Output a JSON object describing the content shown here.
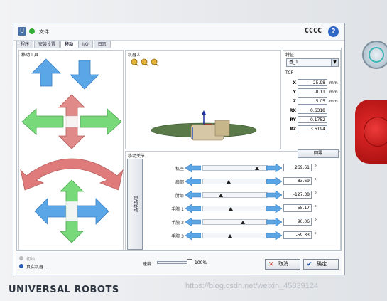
{
  "window": {
    "file_label": "文件",
    "title": "CCCC",
    "help": "?"
  },
  "tabs": [
    {
      "label": "程序"
    },
    {
      "label": "安装设置"
    },
    {
      "label": "移动"
    },
    {
      "label": "I/O"
    },
    {
      "label": "日志"
    }
  ],
  "move_tool": {
    "title": "移动工具"
  },
  "robot": {
    "title": "机器人"
  },
  "feature": {
    "title": "特征",
    "selected": "基_1",
    "tcp_title": "TCP",
    "tcp": [
      {
        "axis": "X",
        "value": "-25.98",
        "unit": "mm"
      },
      {
        "axis": "Y",
        "value": "-0.11",
        "unit": "mm"
      },
      {
        "axis": "Z",
        "value": "5.05",
        "unit": "mm"
      },
      {
        "axis": "RX",
        "value": "0.6318",
        "unit": ""
      },
      {
        "axis": "RY",
        "value": "-0.1752",
        "unit": ""
      },
      {
        "axis": "RZ",
        "value": "3.6194",
        "unit": ""
      }
    ],
    "zero_button": "回零"
  },
  "joints": {
    "title": "移动关节",
    "auto_button": "自动移动",
    "rows": [
      {
        "label": "机座",
        "value": "269.61",
        "unit": "°",
        "level": 0.85
      },
      {
        "label": "肩部",
        "value": "-83.69",
        "unit": "°",
        "level": 0.38
      },
      {
        "label": "肘部",
        "value": "-127.38",
        "unit": "°",
        "level": 0.25
      },
      {
        "label": "手腕 1",
        "value": "-55.17",
        "unit": "°",
        "level": 0.42
      },
      {
        "label": "手腕 2",
        "value": "90.06",
        "unit": "°",
        "level": 0.62
      },
      {
        "label": "手腕 3",
        "value": "-59.33",
        "unit": "°",
        "level": 0.41
      }
    ]
  },
  "bottom": {
    "init_label": "初始",
    "robot_name": "真实机器...",
    "speed_label": "速度",
    "speed_value": "100%",
    "cancel": "取消",
    "ok": "确定"
  },
  "brand": "UNIVERSAL ROBOTS",
  "watermark": "https://blog.csdn.net/weixin_45839124",
  "colors": {
    "blue_arrow": "#5ba6e6",
    "green_arrow": "#78d97a",
    "red_arrow": "#e07b7b",
    "accent": "#2f68c6"
  }
}
